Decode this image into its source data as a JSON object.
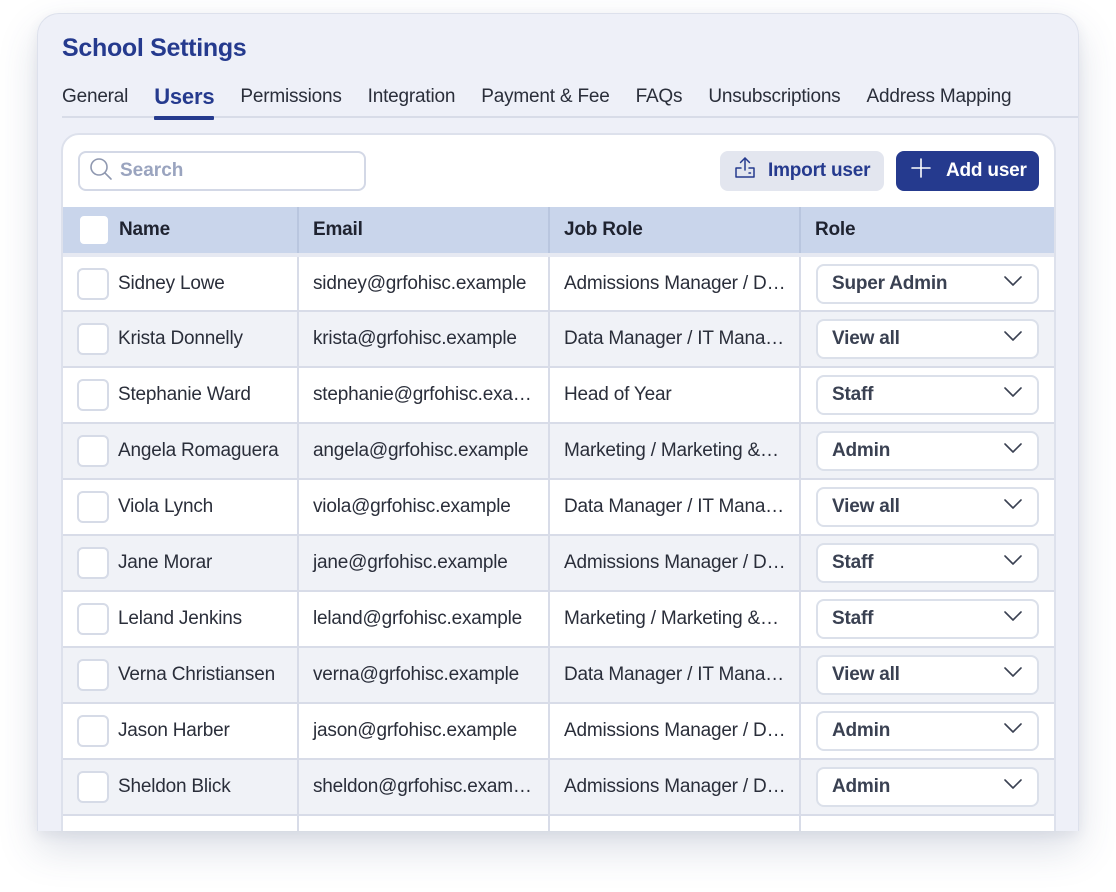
{
  "header": {
    "title": "School Settings"
  },
  "tabs": [
    {
      "label": "General",
      "active": false
    },
    {
      "label": "Users",
      "active": true
    },
    {
      "label": "Permissions",
      "active": false
    },
    {
      "label": "Integration",
      "active": false
    },
    {
      "label": "Payment & Fee",
      "active": false
    },
    {
      "label": "FAQs",
      "active": false
    },
    {
      "label": "Unsubscriptions",
      "active": false
    },
    {
      "label": "Address Mapping",
      "active": false
    }
  ],
  "toolbar": {
    "search_placeholder": "Search",
    "search_value": "",
    "search_icon": "search-icon",
    "import_label": "Import user",
    "import_icon": "upload-icon",
    "add_label": "Add user",
    "add_icon": "plus-icon"
  },
  "colors": {
    "brand": "#253a8e",
    "panel_bg": "#eef0f8",
    "header_row": "#c9d5eb",
    "row_alt": "#f0f2f7"
  },
  "table": {
    "columns": [
      "Name",
      "Email",
      "Job Role",
      "Role"
    ],
    "rows": [
      {
        "name": "Sidney Lowe",
        "email": "sidney@grfohisc.example",
        "job_role": "Admissions Manager / D…",
        "role": "Super Admin"
      },
      {
        "name": "Krista Donnelly",
        "email": "krista@grfohisc.example",
        "job_role": "Data Manager / IT Mana…",
        "role": "View all"
      },
      {
        "name": "Stephanie Ward",
        "email": "stephanie@grfohisc.exa…",
        "job_role": "Head of Year",
        "role": "Staff"
      },
      {
        "name": "Angela Romaguera",
        "email": "angela@grfohisc.example",
        "job_role": "Marketing / Marketing &…",
        "role": "Admin"
      },
      {
        "name": "Viola Lynch",
        "email": "viola@grfohisc.example",
        "job_role": "Data Manager / IT Mana…",
        "role": "View all"
      },
      {
        "name": "Jane Morar",
        "email": "jane@grfohisc.example",
        "job_role": "Admissions Manager / D…",
        "role": "Staff"
      },
      {
        "name": "Leland Jenkins",
        "email": "leland@grfohisc.example",
        "job_role": "Marketing / Marketing &…",
        "role": "Staff"
      },
      {
        "name": "Verna Christiansen",
        "email": "verna@grfohisc.example",
        "job_role": "Data Manager / IT Mana…",
        "role": "View all"
      },
      {
        "name": "Jason Harber",
        "email": "jason@grfohisc.example",
        "job_role": "Admissions Manager / D…",
        "role": "Admin"
      },
      {
        "name": "Sheldon Blick",
        "email": "sheldon@grfohisc.exam…",
        "job_role": "Admissions Manager / D…",
        "role": "Admin"
      }
    ]
  }
}
